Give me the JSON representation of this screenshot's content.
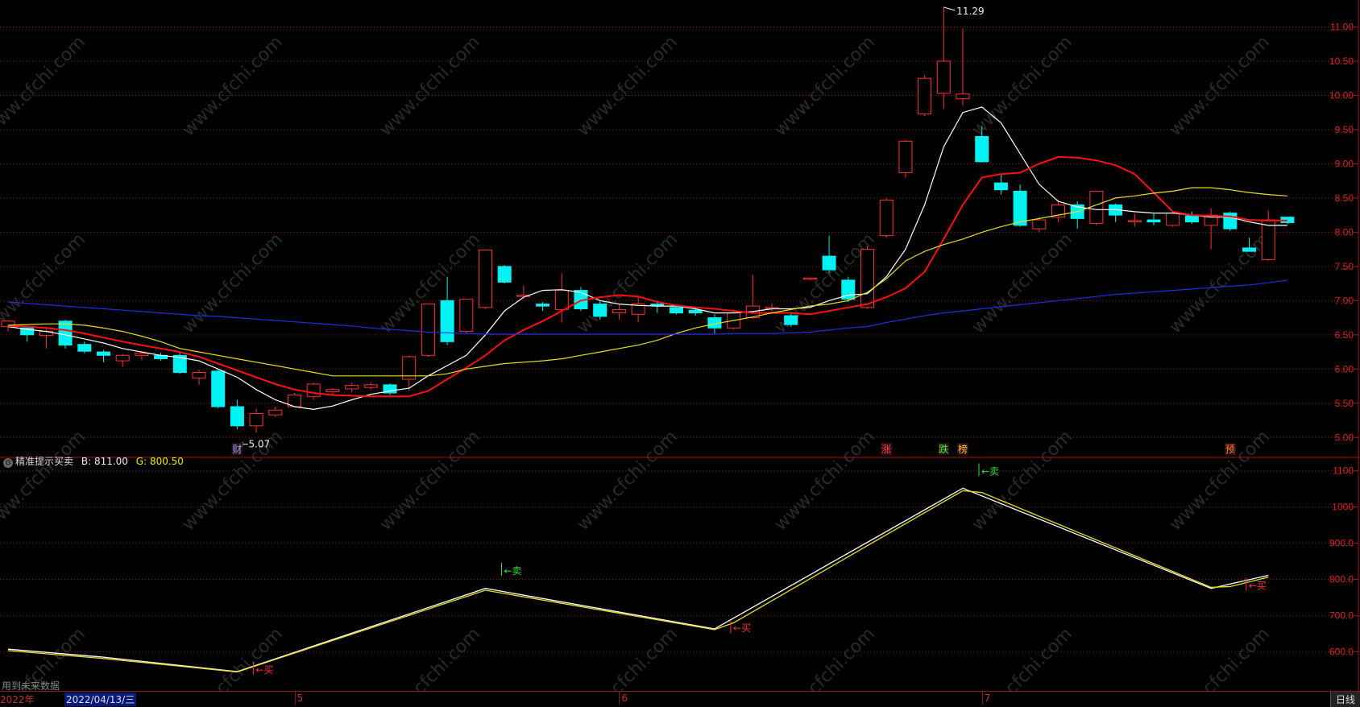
{
  "chart_data": [
    {
      "type": "candlestick",
      "panel": "main",
      "yticks": [
        "11.00",
        "10.50",
        "10.00",
        "9.50",
        "9.00",
        "8.50",
        "8.00",
        "7.50",
        "7.00",
        "6.50",
        "6.00",
        "5.50",
        "5.00"
      ],
      "ylim": [
        4.85,
        11.3
      ],
      "grid": true,
      "candles": [
        {
          "o": 6.62,
          "h": 6.72,
          "l": 6.55,
          "c": 6.7
        },
        {
          "o": 6.6,
          "h": 6.63,
          "l": 6.4,
          "c": 6.5
        },
        {
          "o": 6.49,
          "h": 6.62,
          "l": 6.3,
          "c": 6.55
        },
        {
          "o": 6.7,
          "h": 6.72,
          "l": 6.3,
          "c": 6.35
        },
        {
          "o": 6.36,
          "h": 6.4,
          "l": 6.23,
          "c": 6.26
        },
        {
          "o": 6.25,
          "h": 6.28,
          "l": 6.1,
          "c": 6.2
        },
        {
          "o": 6.12,
          "h": 6.22,
          "l": 6.03,
          "c": 6.2
        },
        {
          "o": 6.2,
          "h": 6.25,
          "l": 6.13,
          "c": 6.23
        },
        {
          "o": 6.2,
          "h": 6.24,
          "l": 6.12,
          "c": 6.15
        },
        {
          "o": 6.2,
          "h": 6.25,
          "l": 5.93,
          "c": 5.95
        },
        {
          "o": 5.87,
          "h": 5.99,
          "l": 5.77,
          "c": 5.95
        },
        {
          "o": 5.97,
          "h": 5.99,
          "l": 5.43,
          "c": 5.45
        },
        {
          "o": 5.45,
          "h": 5.55,
          "l": 5.12,
          "c": 5.17
        },
        {
          "o": 5.17,
          "h": 5.42,
          "l": 5.07,
          "c": 5.35
        },
        {
          "o": 5.33,
          "h": 5.45,
          "l": 5.3,
          "c": 5.4
        },
        {
          "o": 5.45,
          "h": 5.65,
          "l": 5.44,
          "c": 5.62
        },
        {
          "o": 5.6,
          "h": 5.8,
          "l": 5.55,
          "c": 5.78
        },
        {
          "o": 5.67,
          "h": 5.72,
          "l": 5.62,
          "c": 5.7
        },
        {
          "o": 5.71,
          "h": 5.8,
          "l": 5.66,
          "c": 5.76
        },
        {
          "o": 5.73,
          "h": 5.8,
          "l": 5.7,
          "c": 5.77
        },
        {
          "o": 5.77,
          "h": 5.79,
          "l": 5.62,
          "c": 5.65
        },
        {
          "o": 5.85,
          "h": 6.2,
          "l": 5.68,
          "c": 6.18
        },
        {
          "o": 6.2,
          "h": 6.95,
          "l": 6.18,
          "c": 6.95
        },
        {
          "o": 7.0,
          "h": 7.35,
          "l": 6.35,
          "c": 6.4
        },
        {
          "o": 6.55,
          "h": 7.02,
          "l": 6.52,
          "c": 7.02
        },
        {
          "o": 6.9,
          "h": 7.75,
          "l": 6.88,
          "c": 7.74
        },
        {
          "o": 7.5,
          "h": 7.52,
          "l": 7.25,
          "c": 7.27
        },
        {
          "o": 7.06,
          "h": 7.22,
          "l": 7.03,
          "c": 7.08
        },
        {
          "o": 6.95,
          "h": 6.98,
          "l": 6.85,
          "c": 6.92
        },
        {
          "o": 6.87,
          "h": 7.4,
          "l": 6.68,
          "c": 7.15
        },
        {
          "o": 7.15,
          "h": 7.2,
          "l": 6.85,
          "c": 6.88
        },
        {
          "o": 6.95,
          "h": 7.0,
          "l": 6.72,
          "c": 6.77
        },
        {
          "o": 6.82,
          "h": 6.95,
          "l": 6.72,
          "c": 6.87
        },
        {
          "o": 6.8,
          "h": 7.05,
          "l": 6.68,
          "c": 6.95
        },
        {
          "o": 6.95,
          "h": 7.0,
          "l": 6.82,
          "c": 6.93
        },
        {
          "o": 6.9,
          "h": 6.92,
          "l": 6.8,
          "c": 6.82
        },
        {
          "o": 6.86,
          "h": 6.9,
          "l": 6.78,
          "c": 6.82
        },
        {
          "o": 6.75,
          "h": 6.8,
          "l": 6.52,
          "c": 6.6
        },
        {
          "o": 6.6,
          "h": 6.85,
          "l": 6.58,
          "c": 6.82
        },
        {
          "o": 6.75,
          "h": 7.38,
          "l": 6.73,
          "c": 6.92
        },
        {
          "o": 6.9,
          "h": 6.96,
          "l": 6.84,
          "c": 6.9
        },
        {
          "o": 6.78,
          "h": 6.8,
          "l": 6.62,
          "c": 6.65
        },
        {
          "o": 7.32,
          "h": 7.34,
          "l": 7.3,
          "c": 7.33
        },
        {
          "o": 7.65,
          "h": 7.95,
          "l": 7.4,
          "c": 7.45
        },
        {
          "o": 7.3,
          "h": 7.35,
          "l": 6.98,
          "c": 7.02
        },
        {
          "o": 6.9,
          "h": 7.8,
          "l": 6.88,
          "c": 7.75
        },
        {
          "o": 7.95,
          "h": 8.5,
          "l": 7.92,
          "c": 8.47
        },
        {
          "o": 8.87,
          "h": 9.35,
          "l": 8.8,
          "c": 9.33
        },
        {
          "o": 9.73,
          "h": 10.3,
          "l": 9.7,
          "c": 10.25
        },
        {
          "o": 10.03,
          "h": 11.29,
          "l": 9.8,
          "c": 10.5
        },
        {
          "o": 9.95,
          "h": 10.98,
          "l": 9.85,
          "c": 10.02
        },
        {
          "o": 9.4,
          "h": 9.55,
          "l": 9.02,
          "c": 9.03
        },
        {
          "o": 8.72,
          "h": 8.85,
          "l": 8.55,
          "c": 8.62
        },
        {
          "o": 8.6,
          "h": 8.7,
          "l": 8.08,
          "c": 8.1
        },
        {
          "o": 8.05,
          "h": 8.22,
          "l": 8.0,
          "c": 8.18
        },
        {
          "o": 8.22,
          "h": 8.48,
          "l": 8.15,
          "c": 8.4
        },
        {
          "o": 8.4,
          "h": 8.45,
          "l": 8.05,
          "c": 8.2
        },
        {
          "o": 8.13,
          "h": 8.6,
          "l": 8.1,
          "c": 8.6
        },
        {
          "o": 8.4,
          "h": 8.42,
          "l": 8.15,
          "c": 8.25
        },
        {
          "o": 8.17,
          "h": 8.27,
          "l": 8.08,
          "c": 8.17
        },
        {
          "o": 8.18,
          "h": 8.28,
          "l": 8.1,
          "c": 8.15
        },
        {
          "o": 8.1,
          "h": 8.3,
          "l": 8.08,
          "c": 8.28
        },
        {
          "o": 8.24,
          "h": 8.3,
          "l": 8.12,
          "c": 8.15
        },
        {
          "o": 8.1,
          "h": 8.35,
          "l": 7.75,
          "c": 8.25
        },
        {
          "o": 8.28,
          "h": 8.3,
          "l": 8.02,
          "c": 8.05
        },
        {
          "o": 7.77,
          "h": 7.92,
          "l": 7.72,
          "c": 7.72
        },
        {
          "o": 7.6,
          "h": 8.32,
          "l": 7.58,
          "c": 8.18
        },
        {
          "o": 8.22,
          "h": 8.23,
          "l": 8.12,
          "c": 8.14
        }
      ],
      "series": [
        {
          "kind": "ma",
          "color": "#ffffff",
          "values": [
            6.62,
            6.58,
            6.55,
            6.5,
            6.44,
            6.38,
            6.3,
            6.25,
            6.2,
            6.17,
            6.12,
            6.0,
            5.88,
            5.7,
            5.55,
            5.45,
            5.41,
            5.46,
            5.55,
            5.63,
            5.68,
            5.72,
            5.9,
            6.05,
            6.2,
            6.5,
            6.85,
            7.05,
            7.15,
            7.16,
            7.12,
            7.0,
            6.95,
            6.93,
            6.92,
            6.92,
            6.88,
            6.82,
            6.82,
            6.84,
            6.88,
            6.88,
            6.9,
            7.0,
            7.08,
            7.1,
            7.35,
            7.75,
            8.4,
            9.25,
            9.75,
            9.83,
            9.6,
            9.15,
            8.7,
            8.45,
            8.37,
            8.33,
            8.33,
            8.3,
            8.28,
            8.28,
            8.25,
            8.22,
            8.22,
            8.15,
            8.1,
            8.1
          ]
        },
        {
          "kind": "ma",
          "color": "#ff1010",
          "values": [
            6.63,
            6.62,
            6.6,
            6.57,
            6.52,
            6.46,
            6.4,
            6.35,
            6.3,
            6.25,
            6.18,
            6.08,
            5.98,
            5.88,
            5.78,
            5.7,
            5.65,
            5.62,
            5.61,
            5.6,
            5.6,
            5.6,
            5.68,
            5.85,
            6.02,
            6.2,
            6.42,
            6.57,
            6.7,
            6.85,
            7.0,
            7.05,
            7.08,
            7.06,
            6.98,
            6.93,
            6.9,
            6.88,
            6.85,
            6.82,
            6.82,
            6.82,
            6.8,
            6.85,
            6.9,
            6.95,
            7.05,
            7.18,
            7.42,
            7.9,
            8.4,
            8.8,
            8.85,
            8.87,
            9.0,
            9.1,
            9.09,
            9.05,
            8.98,
            8.85,
            8.58,
            8.3,
            8.25,
            8.24,
            8.23,
            8.18,
            8.17,
            8.17
          ]
        },
        {
          "kind": "ma",
          "color": "#e6e020",
          "values": [
            6.64,
            6.65,
            6.66,
            6.66,
            6.64,
            6.6,
            6.55,
            6.48,
            6.4,
            6.3,
            6.25,
            6.2,
            6.15,
            6.1,
            6.05,
            6.0,
            5.95,
            5.9,
            5.9,
            5.9,
            5.9,
            5.9,
            5.9,
            5.93,
            6.0,
            6.04,
            6.08,
            6.1,
            6.12,
            6.15,
            6.2,
            6.25,
            6.3,
            6.35,
            6.42,
            6.52,
            6.6,
            6.66,
            6.71,
            6.76,
            6.82,
            6.87,
            6.92,
            6.95,
            7.0,
            7.12,
            7.32,
            7.58,
            7.72,
            7.82,
            7.9,
            8.0,
            8.08,
            8.15,
            8.2,
            8.25,
            8.3,
            8.4,
            8.5,
            8.53,
            8.57,
            8.6,
            8.65,
            8.65,
            8.62,
            8.58,
            8.55,
            8.53
          ]
        },
        {
          "kind": "ma",
          "color": "#1f2ee6",
          "values": [
            6.98,
            6.96,
            6.94,
            6.92,
            6.9,
            6.88,
            6.86,
            6.84,
            6.82,
            6.8,
            6.78,
            6.77,
            6.75,
            6.73,
            6.71,
            6.69,
            6.67,
            6.65,
            6.63,
            6.6,
            6.58,
            6.56,
            6.54,
            6.53,
            6.52,
            6.51,
            6.51,
            6.51,
            6.51,
            6.51,
            6.51,
            6.51,
            6.51,
            6.51,
            6.51,
            6.51,
            6.51,
            6.51,
            6.52,
            6.52,
            6.52,
            6.53,
            6.54,
            6.57,
            6.6,
            6.62,
            6.68,
            6.73,
            6.78,
            6.82,
            6.85,
            6.88,
            6.91,
            6.94,
            6.97,
            7.0,
            7.03,
            7.06,
            7.09,
            7.11,
            7.13,
            7.15,
            7.17,
            7.19,
            7.21,
            7.23,
            7.26,
            7.3
          ]
        }
      ],
      "annotations": [
        {
          "text": "←5.07",
          "kind": "low",
          "candle": 12,
          "price": 5.07
        },
        {
          "text": "11.29",
          "kind": "high",
          "candle": 49,
          "price": 11.29
        }
      ],
      "markers": [
        {
          "text": "财",
          "candle": 12,
          "color": "#88aaff"
        },
        {
          "text": "涨",
          "candle": 46,
          "color": "#ff4040"
        },
        {
          "text": "跌",
          "candle": 49,
          "color": "#40ff40"
        },
        {
          "text": "榜",
          "candle": 50,
          "color": "#ffc040"
        },
        {
          "text": "预",
          "candle": 64,
          "color": "#ff8020"
        }
      ]
    },
    {
      "type": "line",
      "panel": "indicator",
      "title": "精准提示买卖",
      "toggle_glyph": "⊙",
      "b_label": "B:",
      "b_value": "811.00",
      "g_label": "G:",
      "g_value": "800.50",
      "yticks": [
        "1100",
        "1000",
        "900.0",
        "800.0",
        "700.0",
        "600.0"
      ],
      "ylim": [
        525,
        1115
      ],
      "grid": true,
      "series": [
        {
          "name": "B",
          "color": "#ffffff",
          "points": [
            [
              0,
              607
            ],
            [
              5,
              585
            ],
            [
              12,
              545
            ],
            [
              25,
              775
            ],
            [
              37,
              663
            ],
            [
              50,
              1052
            ],
            [
              63,
              775
            ],
            [
              66,
              811
            ]
          ]
        },
        {
          "name": "G",
          "color": "#e6e020",
          "points": [
            [
              0,
              603
            ],
            [
              5,
              581
            ],
            [
              12,
              544
            ],
            [
              25,
              770
            ],
            [
              37,
              661
            ],
            [
              38,
              680
            ],
            [
              50,
              1045
            ],
            [
              51,
              1040
            ],
            [
              63,
              778
            ],
            [
              64,
              780
            ],
            [
              66,
              806
            ]
          ]
        }
      ],
      "signals": [
        {
          "text": "←卖",
          "kind": "sell",
          "candle": 25,
          "value": 770,
          "color": "#30e030"
        },
        {
          "text": "←卖",
          "kind": "sell",
          "candle": 50,
          "value": 1045,
          "color": "#30e030"
        },
        {
          "text": "←买",
          "kind": "buy",
          "candle": 12,
          "value": 550,
          "color": "#ff3030"
        },
        {
          "text": "←买",
          "kind": "buy",
          "candle": 37,
          "value": 665,
          "color": "#ff3030"
        },
        {
          "text": "←买",
          "kind": "buy",
          "candle": 64,
          "value": 782,
          "color": "#ff3030"
        }
      ]
    }
  ],
  "footer": {
    "future_note": "用到未来数据",
    "year": "2022年",
    "cursor_date": "2022/04/13/三",
    "months": [
      {
        "label": "5",
        "candle": 15
      },
      {
        "label": "6",
        "candle": 32
      },
      {
        "label": "7",
        "candle": 51
      }
    ],
    "period": "日线"
  },
  "watermark": "www.cfchi.com",
  "colors": {
    "up": "#ff3030",
    "down": "#00f2f2",
    "grid": "#8b1a1a",
    "axis": "#a01818"
  }
}
